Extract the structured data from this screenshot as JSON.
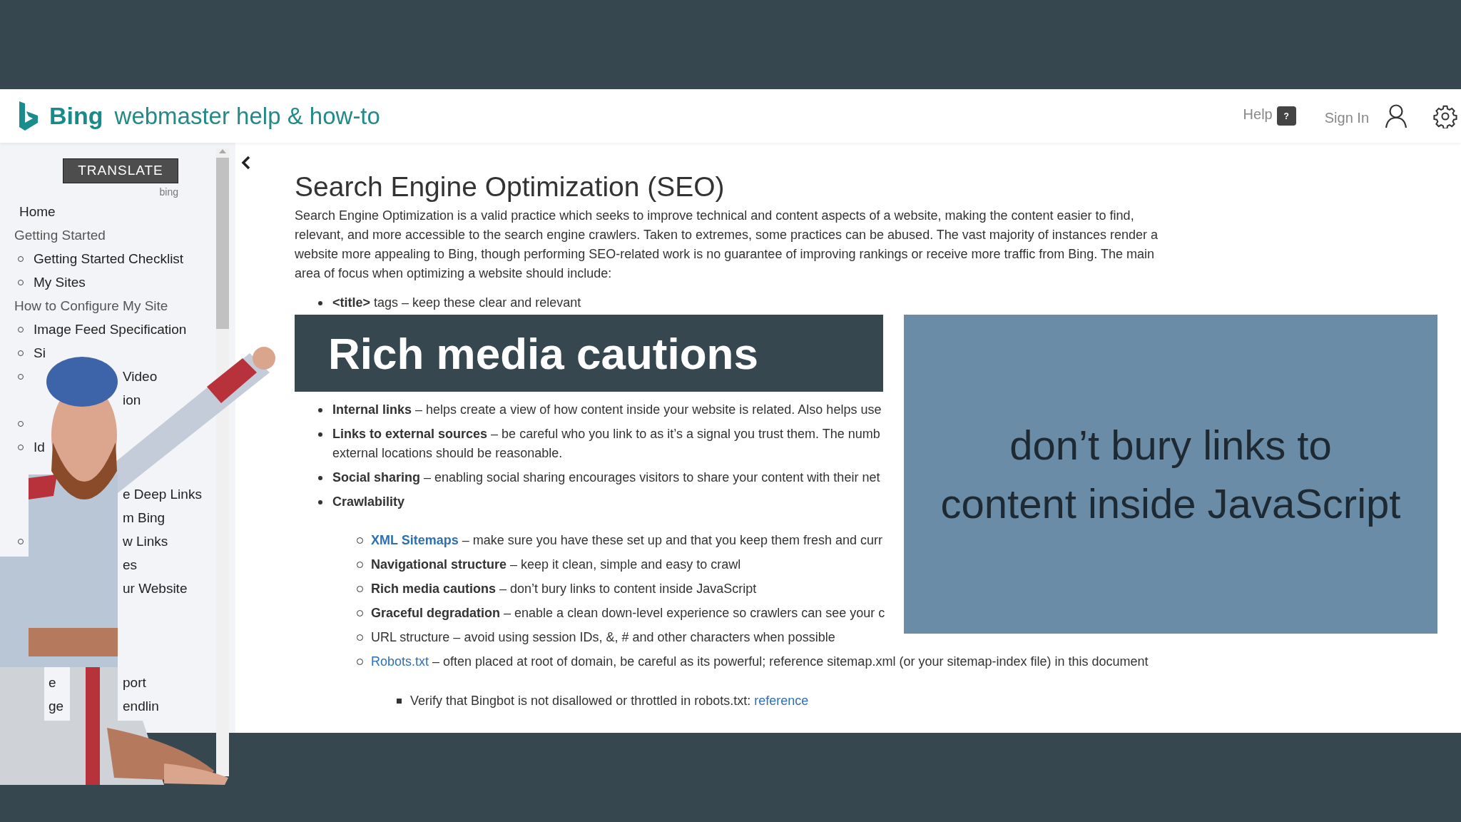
{
  "header": {
    "logo_text": "Bing",
    "title": "webmaster help & how-to",
    "help": "Help",
    "help_badge": "?",
    "sign_in": "Sign In"
  },
  "sidebar": {
    "translate": "TRANSLATE",
    "translate_brand": "bing",
    "items": [
      {
        "kind": "link",
        "label": "Home"
      },
      {
        "kind": "heading",
        "label": "Getting Started"
      },
      {
        "kind": "bullet",
        "label": "Getting Started Checklist"
      },
      {
        "kind": "bullet",
        "label": "My Sites"
      },
      {
        "kind": "heading",
        "label": "How to Configure My Site"
      },
      {
        "kind": "bullet",
        "label": "Image Feed Specification"
      },
      {
        "kind": "bullet",
        "label": "Si"
      },
      {
        "kind": "bullet",
        "tail": "Video"
      },
      {
        "kind": "covered",
        "tail": "ion"
      },
      {
        "kind": "bullet"
      },
      {
        "kind": "bullet",
        "label": "Id"
      },
      {
        "kind": "covered"
      },
      {
        "kind": "covered",
        "tail": "e Deep Links"
      },
      {
        "kind": "covered",
        "tail": "m Bing"
      },
      {
        "kind": "bullet",
        "tail": "w Links"
      },
      {
        "kind": "covered",
        "tail": "es"
      },
      {
        "kind": "covered",
        "tail": "ur Website"
      },
      {
        "kind": "covered"
      },
      {
        "kind": "covered"
      },
      {
        "kind": "covered"
      },
      {
        "kind": "covered",
        "label": "e",
        "tail": "port"
      },
      {
        "kind": "covered",
        "label": "ge",
        "tail": "endlin"
      }
    ]
  },
  "article": {
    "title": "Search Engine Optimization (SEO)",
    "intro": "Search Engine Optimization is a valid practice which seeks to improve technical and content aspects of a website, making the content easier to find, relevant, and more accessible to the search engine crawlers.  Taken to extremes, some practices can be abused.  The vast majority of instances render a website more appealing to Bing, though performing SEO-related work is no guarantee of improving rankings or receive more traffic from Bing.  The main area of focus when optimizing a website should include:",
    "first_item": "**<title>** tags – keep these clear and relevant",
    "items": [
      {
        "text": "**Internal links** – helps create a view of how content inside your website is related.  Also helps use"
      },
      {
        "text": "**Links to external sources** – be careful who you link to as it’s a signal you trust them.  The numb",
        "text_2": "external locations should be reasonable."
      },
      {
        "text": "**Social sharing** – enabling social sharing encourages visitors to share your content with their net"
      },
      {
        "text": "**Crawlability**"
      }
    ],
    "sub_items": [
      {
        "link": "**XML Sitemaps**",
        "text": " – make sure you have these set up and that you keep them fresh and curr"
      },
      {
        "text": "**Navigational structure** – keep it clean, simple and easy to crawl"
      },
      {
        "text": "**Rich media cautions** – don’t bury links to content inside JavaScript"
      },
      {
        "text": "**Graceful degradation** – enable a clean down-level experience so crawlers can see your c"
      },
      {
        "text": "URL structure – avoid using session IDs, &, # and other characters when possible"
      },
      {
        "link": "Robots.txt",
        "text": " – often placed at root of domain, be careful as its powerful; reference sitemap.xml (or your sitemap-index file) in this document"
      }
    ],
    "sub_sub_items": [
      {
        "text": "Verify that Bingbot is not disallowed or throttled in robots.txt: ",
        "link": "reference"
      }
    ]
  },
  "banner": {
    "title": "Rich media cautions"
  },
  "callout": {
    "text": "don’t bury links to content inside JavaScript"
  }
}
